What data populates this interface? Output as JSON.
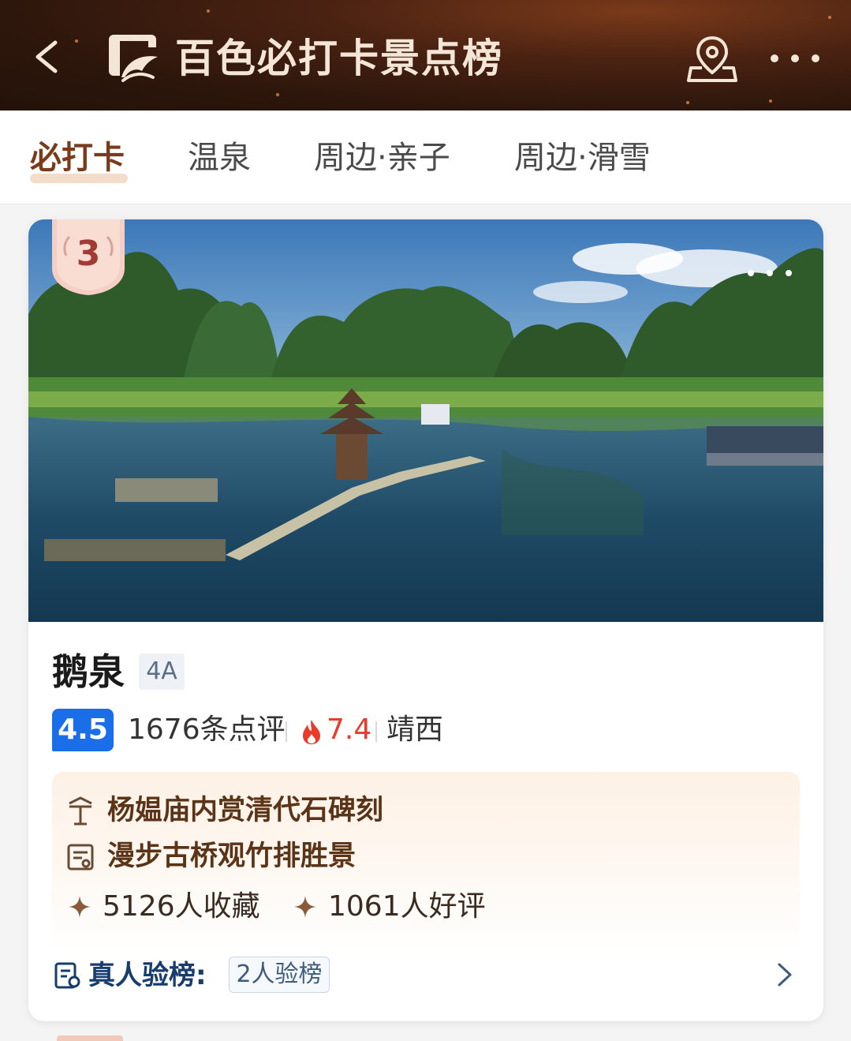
{
  "header": {
    "title": "百色必打卡景点榜",
    "back_icon": "chevron-left-icon",
    "logo_icon": "attraction-ranking-logo-icon",
    "location_icon": "map-pin-icon",
    "more_icon": "more-dots-icon"
  },
  "tabs": [
    {
      "label": "必打卡",
      "active": true
    },
    {
      "label": "温泉",
      "active": false
    },
    {
      "label": "周边·亲子",
      "active": false
    },
    {
      "label": "周边·滑雪",
      "active": false
    }
  ],
  "card": {
    "rank": "3",
    "name": "鹅泉",
    "level": "4A",
    "score": "4.5",
    "reviews": "1676条点评",
    "heat": "7.4",
    "location": "靖西",
    "highlights": [
      {
        "icon": "pavilion-icon",
        "text": "杨媪庙内赏清代石碑刻"
      },
      {
        "icon": "certificate-icon",
        "text": "漫步古桥观竹排胜景"
      }
    ],
    "stats": [
      {
        "icon": "sparkle-icon",
        "text": "5126人收藏"
      },
      {
        "icon": "sparkle-icon",
        "text": "1061人好评"
      }
    ],
    "verify": {
      "label": "真人验榜:",
      "badge": "2人验榜"
    }
  },
  "colors": {
    "header_bg": "#2d160c",
    "accent_brown": "#7a3b1c",
    "score_blue": "#1a6fe8",
    "heat_red": "#e83b2c"
  }
}
